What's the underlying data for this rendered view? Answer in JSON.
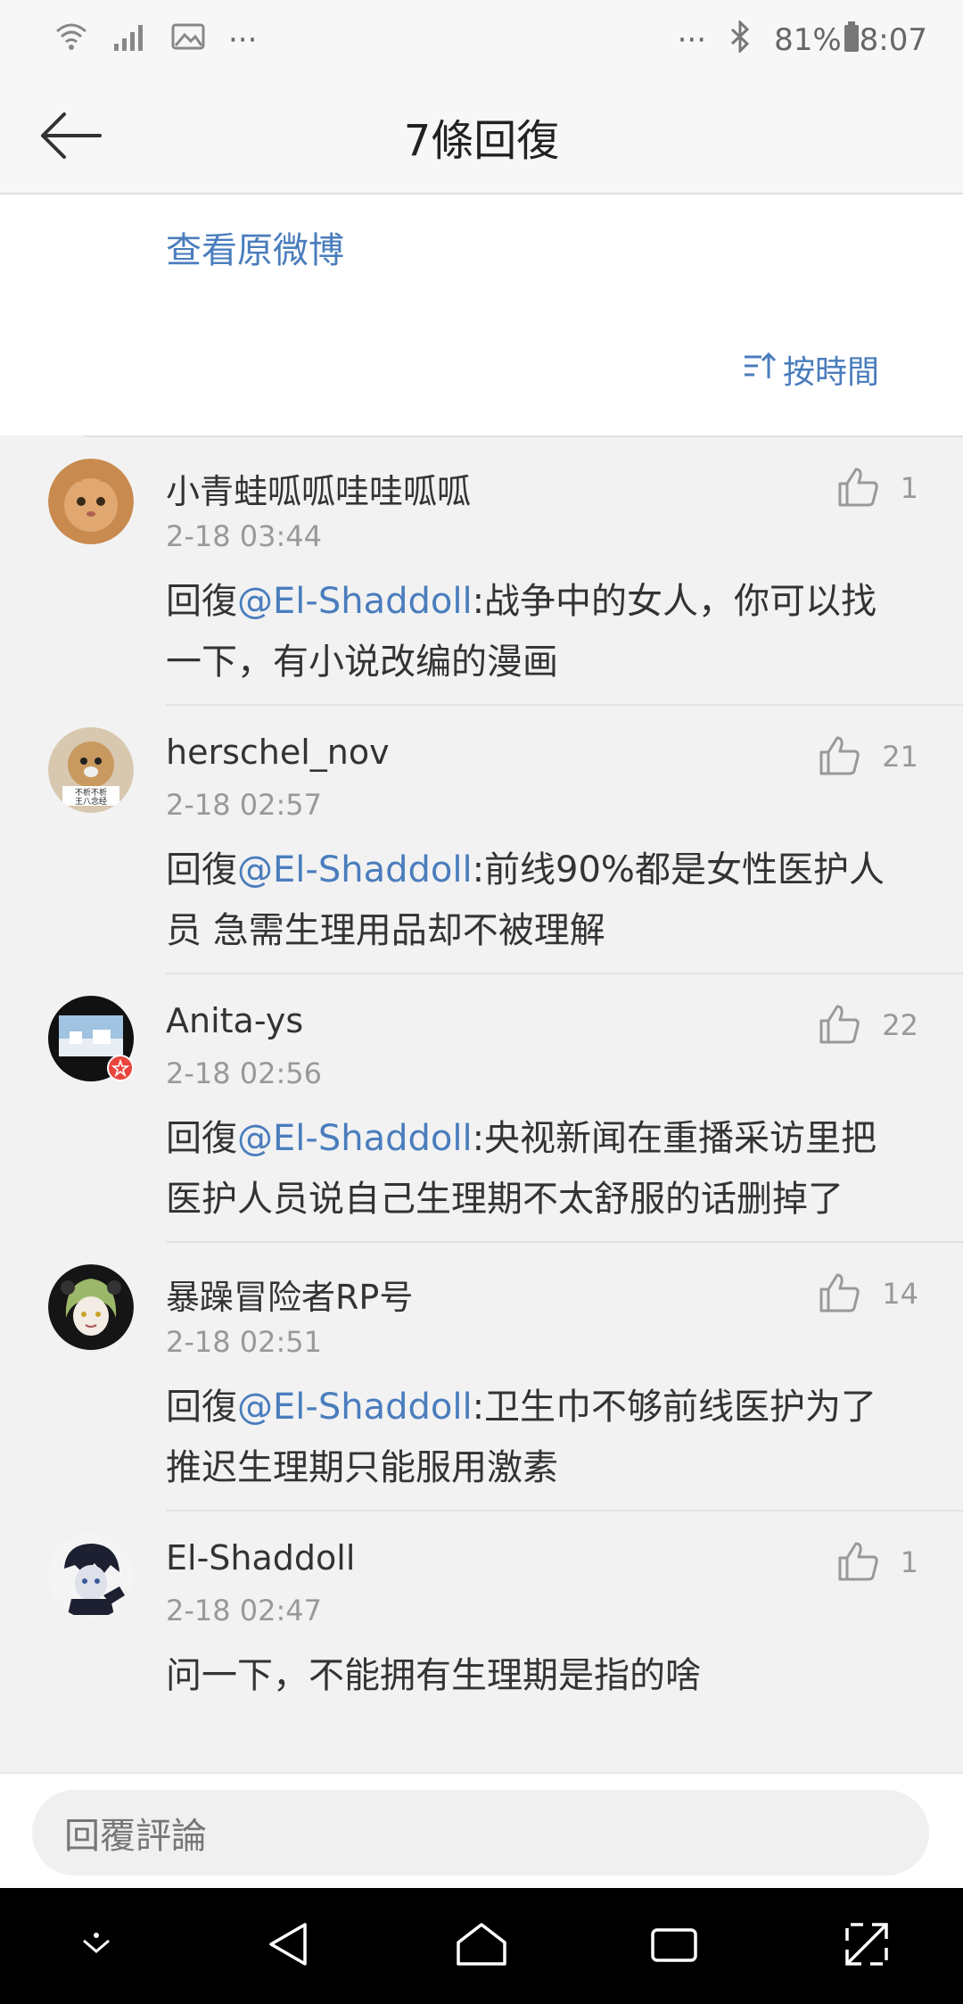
{
  "status_bar": {
    "battery": "81%",
    "time": "8:07",
    "left_dots": "···",
    "right_dots": "···",
    "icons": [
      "wifi-icon",
      "signal-icon",
      "image-icon",
      "bluetooth-icon",
      "battery-icon"
    ]
  },
  "header": {
    "title": "7條回復",
    "back_icon": "back-arrow-icon"
  },
  "top": {
    "view_original": "查看原微博",
    "sort_label": "按時間",
    "sort_icon": "sort-icon"
  },
  "comments": [
    {
      "username": "小青蛙呱呱哇哇呱呱",
      "time": "2-18 03:44",
      "reply_prefix": "回復",
      "mention": "@El-Shaddoll",
      "text": ":战争中的女人，你可以找一下，有小说改编的漫画",
      "likes": "1"
    },
    {
      "username": "herschel_nov",
      "time": "2-18 02:57",
      "reply_prefix": "回復",
      "mention": "@El-Shaddoll",
      "text": ":前线90%都是女性医护人员  急需生理用品却不被理解",
      "likes": "21"
    },
    {
      "username": "Anita-ys",
      "time": "2-18 02:56",
      "reply_prefix": "回復",
      "mention": "@El-Shaddoll",
      "text": ":央视新闻在重播采访里把医护人员说自己生理期不太舒服的话删掉了",
      "likes": "22"
    },
    {
      "username": "暴躁冒险者RP号",
      "time": "2-18 02:51",
      "reply_prefix": "回復",
      "mention": "@El-Shaddoll",
      "text": ":卫生巾不够前线医护为了推迟生理期只能服用激素",
      "likes": "14"
    },
    {
      "username": "El-Shaddoll",
      "time": "2-18 02:47",
      "reply_prefix": "",
      "mention": "",
      "text": "问一下，不能拥有生理期是指的啥",
      "likes": "1"
    }
  ],
  "reply_bar": {
    "placeholder": "回覆評論"
  },
  "nav_bar": {
    "icons": [
      "chevron-down-icon",
      "back-triangle-icon",
      "home-icon",
      "recents-icon",
      "expand-icon"
    ]
  },
  "colors": {
    "accent": "#4a7dbd",
    "background": "#f2f2f2"
  }
}
